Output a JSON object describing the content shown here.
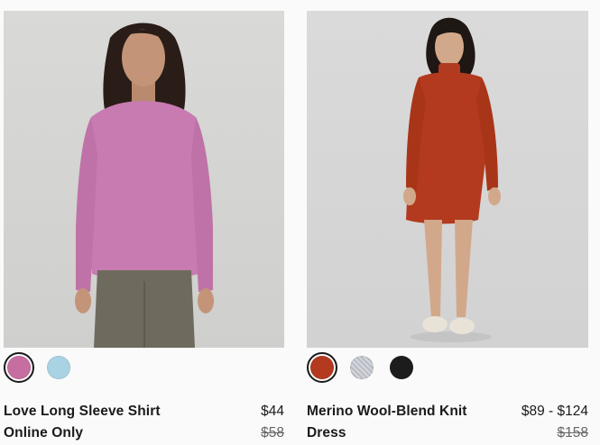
{
  "products": [
    {
      "name_line1": "Love Long Sleeve Shirt",
      "name_line2": "Online Only",
      "price": "$44",
      "original_price": "$58",
      "photo_icon": "model-pink-long-sleeve-photo",
      "swatches": [
        {
          "color": "#c76ea0",
          "selected": true
        },
        {
          "color": "#a9d3e3",
          "selected": false
        }
      ]
    },
    {
      "name_line1": "Merino Wool-Blend Knit",
      "name_line2": "Dress",
      "price": "$89 - $124",
      "original_price": "$158",
      "photo_icon": "model-red-knit-dress-photo",
      "swatches": [
        {
          "color": "#b33a1f",
          "selected": true
        },
        {
          "color": "#b9bcc4",
          "selected": false
        },
        {
          "color": "#1c1c1c",
          "selected": false
        }
      ]
    }
  ]
}
